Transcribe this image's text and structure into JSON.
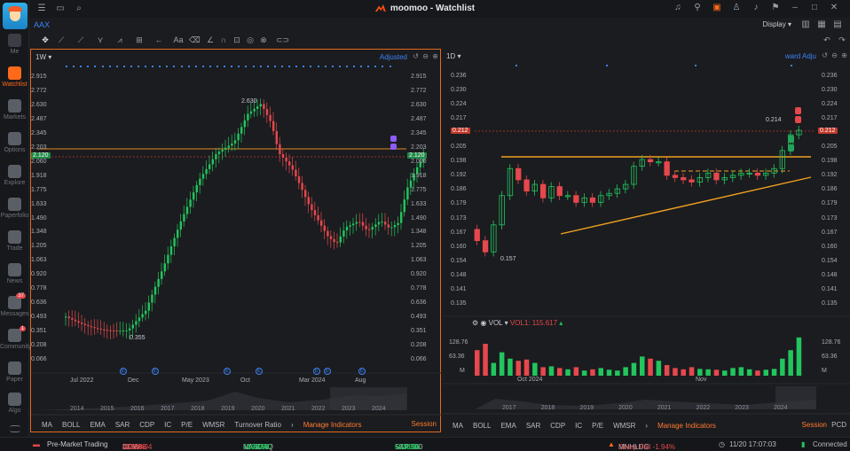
{
  "app": {
    "title": "moomoo - Watchlist"
  },
  "sidebar": {
    "items": [
      {
        "label": "Me"
      },
      {
        "label": "Watchlist"
      },
      {
        "label": "Markets"
      },
      {
        "label": "Options"
      },
      {
        "label": "Explore"
      },
      {
        "label": "Paperfolio"
      },
      {
        "label": "Trade"
      },
      {
        "label": "News"
      },
      {
        "label": "Messages",
        "badge": "37"
      },
      {
        "label": "Community",
        "badge": "1"
      },
      {
        "label": "Paper"
      },
      {
        "label": "Algo"
      }
    ]
  },
  "symbol": "AAX",
  "toolbar": {
    "display_label": "Display"
  },
  "left_chart": {
    "period": "1W",
    "adjust_label": "Adjusted",
    "price_axis": [
      "2.915",
      "2.772",
      "2.630",
      "2.487",
      "2.345",
      "2.203",
      "2.060",
      "1.918",
      "1.775",
      "1.633",
      "1.490",
      "1.348",
      "1.205",
      "1.063",
      "0.920",
      "0.778",
      "0.636",
      "0.493",
      "0.351",
      "0.208",
      "0.066"
    ],
    "current_price": "2.120",
    "high_label": "2.630",
    "low_label": "0.355",
    "dates": [
      "Jul 2022",
      "Dec",
      "May 2023",
      "Oct",
      "Mar 2024",
      "Aug"
    ],
    "years": [
      "2014",
      "2015",
      "2016",
      "2017",
      "2018",
      "2019",
      "2020",
      "2021",
      "2022",
      "2023",
      "2024"
    ],
    "indicators": [
      "MA",
      "BOLL",
      "EMA",
      "SAR",
      "CDP",
      "IC",
      "P/E",
      "WMSR",
      "Turnover Ratio"
    ],
    "manage_label": "Manage Indicators",
    "session_label": "Session"
  },
  "right_chart": {
    "period": "1D",
    "adjust_label": "ward Adju",
    "price_axis": [
      "0.236",
      "0.230",
      "0.224",
      "0.217",
      "0.211",
      "0.205",
      "0.198",
      "0.192",
      "0.186",
      "0.179",
      "0.173",
      "0.167",
      "0.160",
      "0.154",
      "0.148",
      "0.141",
      "0.135"
    ],
    "current_price": "0.212",
    "high_label": "0.214",
    "low_label": "0.157",
    "vol_header": {
      "name": "VOL",
      "vol1": "VOL1: 115.617"
    },
    "vol_axis": [
      "128.76",
      "63.36",
      "M"
    ],
    "dates": [
      "Oct 2024",
      "Nov"
    ],
    "years": [
      "2017",
      "2018",
      "2019",
      "2020",
      "2021",
      "2022",
      "2023",
      "2024"
    ],
    "indicators": [
      "MA",
      "BOLL",
      "EMA",
      "SAR",
      "CDP",
      "IC",
      "P/E",
      "WMSR"
    ],
    "manage_label": "Manage Indicators",
    "session_label": "Session",
    "pcd_label": "PCD"
  },
  "statusbar": {
    "premarket": "Pre-Market Trading",
    "dow": {
      "name": "DOW",
      "value": "43268.94",
      "change": "-120.66",
      "pct": "-0.28%"
    },
    "nasdaq": {
      "name": "NASDAQ",
      "value": "18987.47",
      "change": "+195.66",
      "pct": "+1.04%"
    },
    "sp500": {
      "name": "S&P 500",
      "value": "5916.98",
      "change": "+23.36",
      "pct": "+0.40%"
    },
    "alert": {
      "symbol": "MNHLDG",
      "text": "Sharp Fall -1.94%"
    },
    "time": "11/20 17:07:03",
    "connection": "Connected"
  },
  "colors": {
    "accent": "#ff6a1a",
    "up": "#22c55e",
    "down": "#e5484d",
    "link": "#3b82f6"
  }
}
